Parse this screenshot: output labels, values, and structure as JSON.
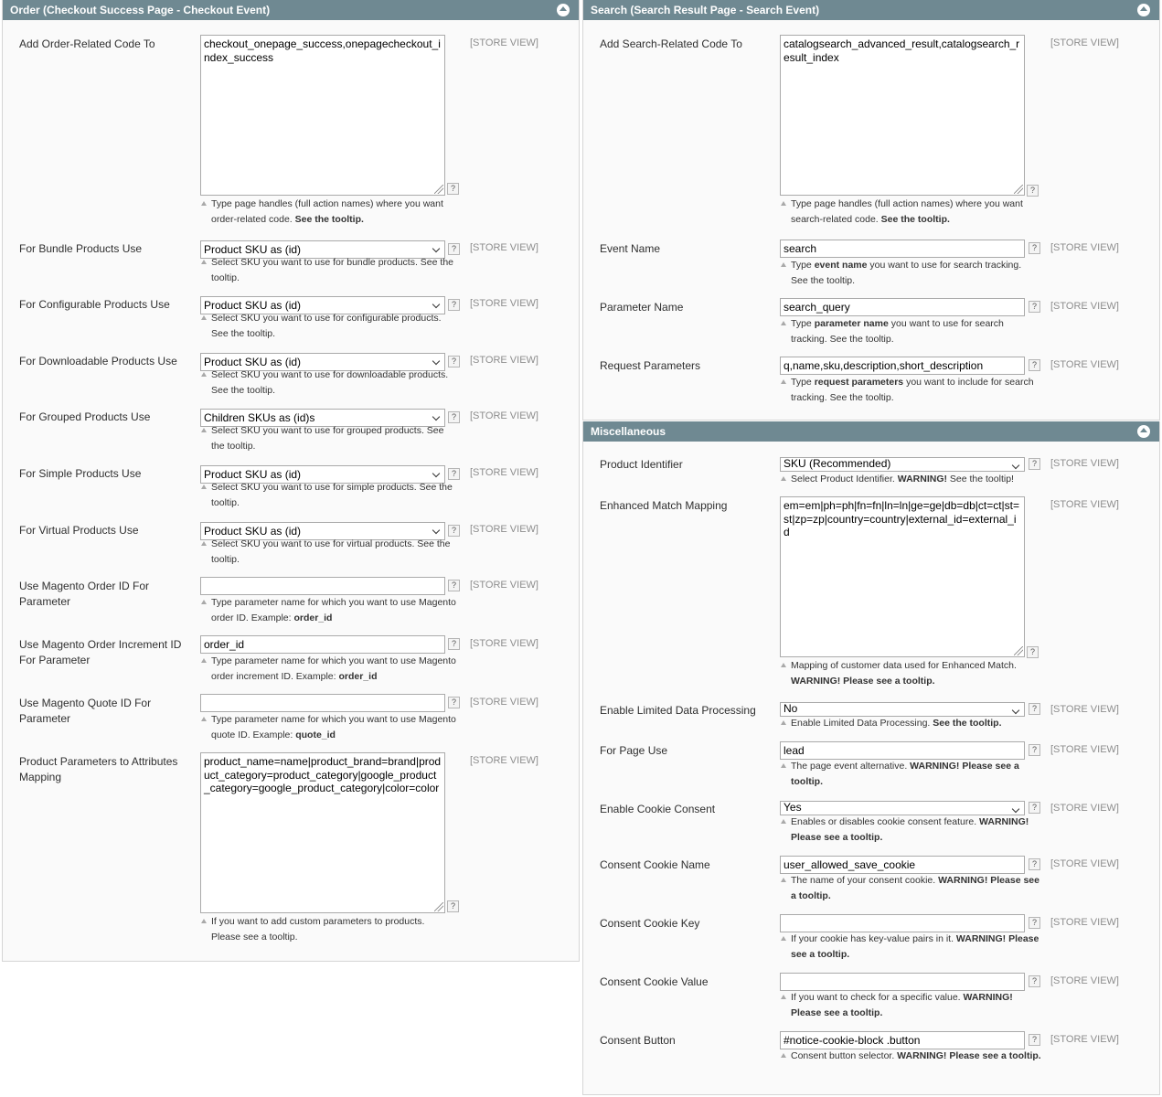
{
  "store_view": "[STORE VIEW]",
  "order": {
    "title": "Order (Checkout Success Page - Checkout Event)",
    "rows": [
      {
        "label": "Add Order-Related Code To",
        "value": "checkout_onepage_success,onepagecheckout_index_success",
        "note_pre": "Type page handles (full action names) where you want order-related code. ",
        "note_bold": "See the tooltip.",
        "note_post": ""
      },
      {
        "label": "For Bundle Products Use",
        "value": "Product SKU as (id)",
        "note_pre": "Select SKU you want to use for bundle products. See the tooltip.",
        "note_bold": "",
        "note_post": ""
      },
      {
        "label": "For Configurable Products Use",
        "value": "Product SKU as (id)",
        "note_pre": "Select SKU you want to use for configurable products. See the tooltip.",
        "note_bold": "",
        "note_post": ""
      },
      {
        "label": "For Downloadable Products Use",
        "value": "Product SKU as (id)",
        "note_pre": "Select SKU you want to use for downloadable products. See the tooltip.",
        "note_bold": "",
        "note_post": ""
      },
      {
        "label": "For Grouped Products Use",
        "value": "Children SKUs as (id)s",
        "note_pre": "Select SKU you want to use for grouped products. See the tooltip.",
        "note_bold": "",
        "note_post": ""
      },
      {
        "label": "For Simple Products Use",
        "value": "Product SKU as (id)",
        "note_pre": "Select SKU you want to use for simple products. See the tooltip.",
        "note_bold": "",
        "note_post": ""
      },
      {
        "label": "For Virtual Products Use",
        "value": "Product SKU as (id)",
        "note_pre": "Select SKU you want to use for virtual products. See the tooltip.",
        "note_bold": "",
        "note_post": ""
      },
      {
        "label": "Use Magento Order ID For Parameter",
        "value": "",
        "note_pre": "Type parameter name for which you want to use Magento order ID. Example: ",
        "note_bold": "order_id",
        "note_post": ""
      },
      {
        "label": "Use Magento Order Increment ID For Parameter",
        "value": "order_id",
        "note_pre": "Type parameter name for which you want to use Magento order increment ID. Example: ",
        "note_bold": "order_id",
        "note_post": ""
      },
      {
        "label": "Use Magento Quote ID For Parameter",
        "value": "",
        "note_pre": "Type parameter name for which you want to use Magento quote ID. Example: ",
        "note_bold": "quote_id",
        "note_post": ""
      },
      {
        "label": "Product Parameters to Attributes Mapping",
        "value": "product_name=name|product_brand=brand|product_category=product_category|google_product_category=google_product_category|color=color",
        "note_pre": "If you want to add custom parameters to products. Please see a tooltip.",
        "note_bold": "",
        "note_post": ""
      }
    ]
  },
  "search": {
    "title": "Search (Search Result Page - Search Event)",
    "rows": [
      {
        "label": "Add Search-Related Code To",
        "value": "catalogsearch_advanced_result,catalogsearch_result_index",
        "note_pre": "Type page handles (full action names) where you want search-related code. ",
        "note_bold": "See the tooltip.",
        "note_post": ""
      },
      {
        "label": "Event Name",
        "value": "search",
        "note_pre": "Type ",
        "note_bold": "event name",
        "note_post": " you want to use for search tracking. See the tooltip."
      },
      {
        "label": "Parameter Name",
        "value": "search_query",
        "note_pre": "Type ",
        "note_bold": "parameter name",
        "note_post": " you want to use for search tracking. See the tooltip."
      },
      {
        "label": "Request Parameters",
        "value": "q,name,sku,description,short_description",
        "note_pre": "Type ",
        "note_bold": "request parameters",
        "note_post": " you want to include for search tracking. See the tooltip."
      }
    ]
  },
  "misc": {
    "title": "Miscellaneous",
    "rows": [
      {
        "label": "Product Identifier",
        "value": "SKU (Recommended)",
        "note_pre": "Select Product Identifier. ",
        "note_bold": "WARNING!",
        "note_post": " See the tooltip!"
      },
      {
        "label": "Enhanced Match Mapping",
        "value": "em=em|ph=ph|fn=fn|ln=ln|ge=ge|db=db|ct=ct|st=st|zp=zp|country=country|external_id=external_id",
        "note_pre": "Mapping of customer data used for Enhanced Match. ",
        "note_bold": "WARNING! Please see a tooltip.",
        "note_post": ""
      },
      {
        "label": "Enable Limited Data Processing",
        "value": "No",
        "note_pre": "Enable Limited Data Processing. ",
        "note_bold": "See the tooltip.",
        "note_post": ""
      },
      {
        "label": "For Page Use",
        "value": "lead",
        "note_pre": "The page event alternative. ",
        "note_bold": "WARNING! Please see a tooltip.",
        "note_post": ""
      },
      {
        "label": "Enable Cookie Consent",
        "value": "Yes",
        "note_pre": "Enables or disables cookie consent feature. ",
        "note_bold": "WARNING! Please see a tooltip.",
        "note_post": ""
      },
      {
        "label": "Consent Cookie Name",
        "value": "user_allowed_save_cookie",
        "note_pre": "The name of your consent cookie. ",
        "note_bold": "WARNING! Please see a tooltip.",
        "note_post": ""
      },
      {
        "label": "Consent Cookie Key",
        "value": "",
        "note_pre": "If your cookie has key-value pairs in it. ",
        "note_bold": "WARNING! Please see a tooltip.",
        "note_post": ""
      },
      {
        "label": "Consent Cookie Value",
        "value": "",
        "note_pre": "If you want to check for a specific value. ",
        "note_bold": "WARNING! Please see a tooltip.",
        "note_post": ""
      },
      {
        "label": "Consent Button",
        "value": "#notice-cookie-block .button",
        "note_pre": "Consent button selector. ",
        "note_bold": "WARNING! Please see a tooltip.",
        "note_post": ""
      }
    ]
  }
}
